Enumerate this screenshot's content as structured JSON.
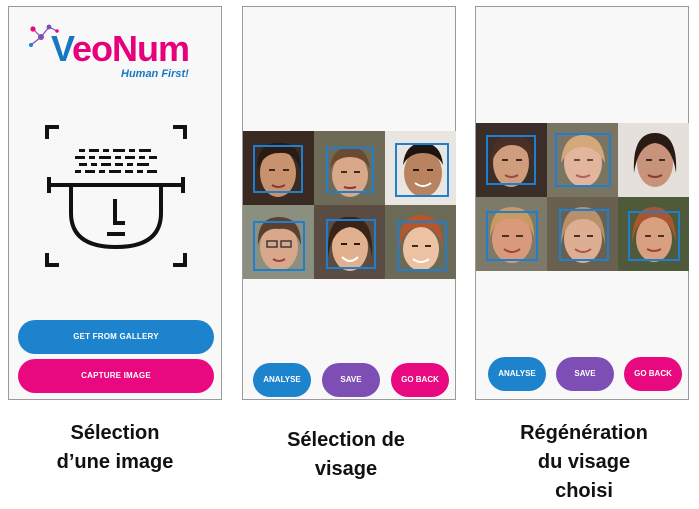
{
  "screens": [
    {
      "logo": {
        "v": "V",
        "rest": "eoNum",
        "tagline": "Human First!"
      },
      "buttons": {
        "gallery": "GET FROM GALLERY",
        "capture": "CAPTURE IMAGE"
      }
    },
    {
      "buttons": {
        "analyse": "ANALYSE",
        "save": "SAVE",
        "back": "GO BACK"
      }
    },
    {
      "buttons": {
        "analyse": "ANALYSE",
        "save": "SAVE",
        "back": "GO BACK"
      }
    }
  ],
  "captions": [
    [
      "Sélection",
      "d’une image"
    ],
    [
      "Sélection de",
      "visage"
    ],
    [
      "Régénération",
      "du visage",
      "choisi"
    ]
  ],
  "colors": {
    "blue": "#1c83cc",
    "purple": "#7d4fb4",
    "pink": "#e8087f",
    "detect_box": "#1e7fd0"
  }
}
